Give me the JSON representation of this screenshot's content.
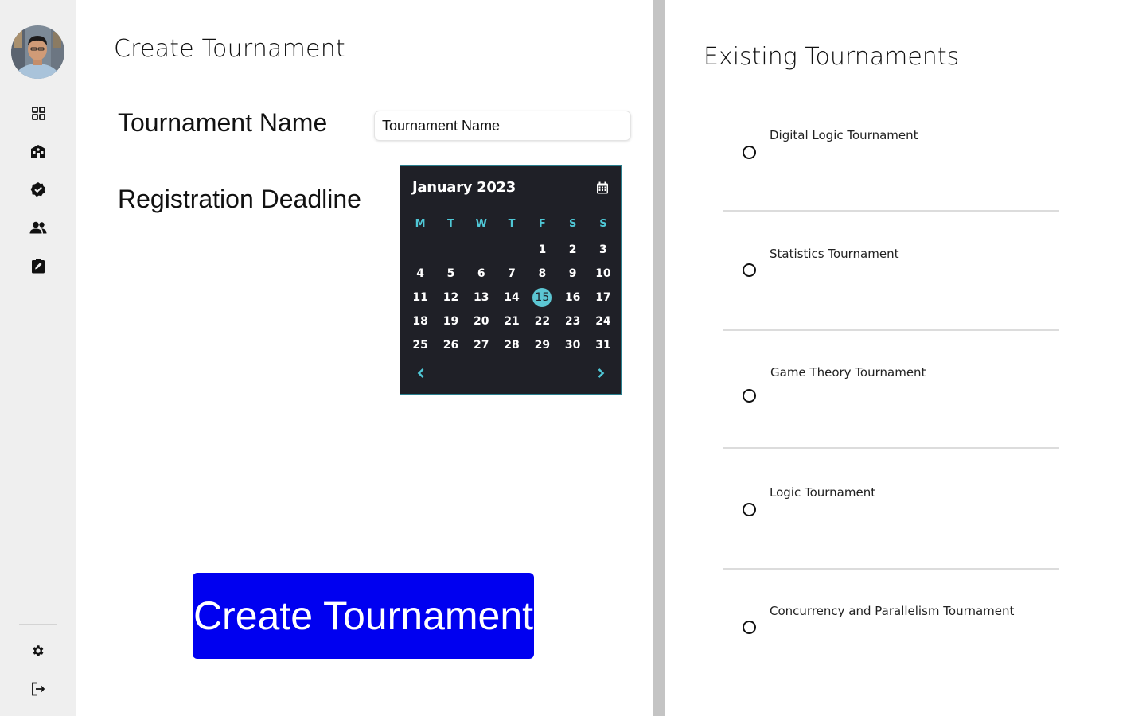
{
  "sidebar": {
    "avatar_alt": "User avatar",
    "nav": [
      "dashboard-icon",
      "school-icon",
      "verified-icon",
      "people-icon",
      "assignment-icon"
    ],
    "bottom": [
      "settings-icon",
      "logout-icon"
    ]
  },
  "form": {
    "title": "Create Tournament",
    "name_label": "Tournament Name",
    "name_placeholder": "Tournament Name",
    "deadline_label": "Registration Deadline",
    "submit_label": "Create Tournament"
  },
  "calendar": {
    "month_title": "January 2023",
    "weekdays": [
      "M",
      "T",
      "W",
      "T",
      "F",
      "S",
      "S"
    ],
    "leading_blanks": 4,
    "days_in_month": 31,
    "selected_day": 15,
    "accent_color": "#5cc6d3",
    "background_color": "#1f2027"
  },
  "existing": {
    "title": "Existing Tournaments",
    "tournaments": [
      "Digital Logic Tournament",
      "Statistics Tournament",
      "Game Theory Tournament",
      "Logic Tournament",
      "Concurrency and Parallelism Tournament"
    ]
  },
  "colors": {
    "primary_button": "#0000f0",
    "sidebar_bg": "#efefef",
    "divider": "#c4c4c4"
  }
}
